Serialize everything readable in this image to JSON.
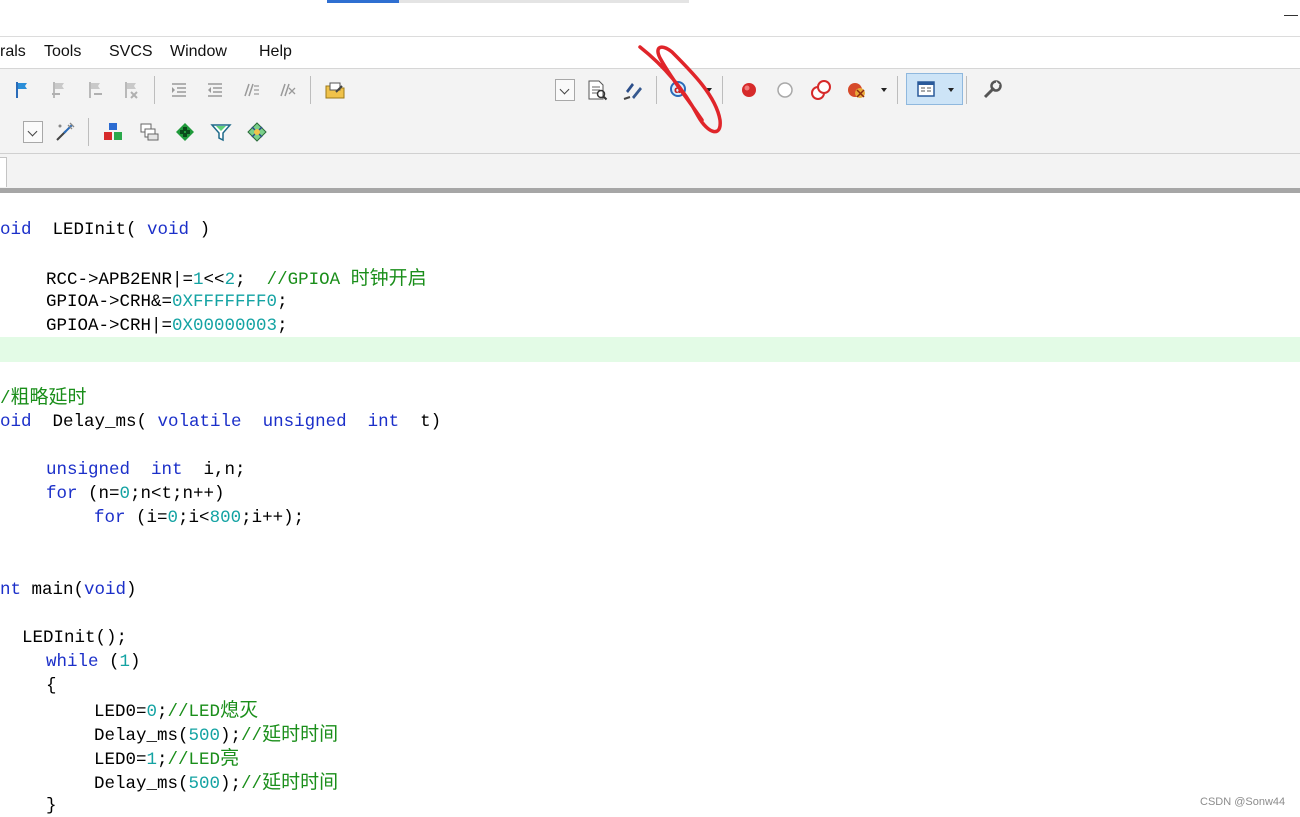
{
  "window": {
    "minimize_glyph": "—"
  },
  "menu": {
    "items": [
      "rals",
      "Tools",
      "SVCS",
      "Window",
      "Help"
    ]
  },
  "toolbar": {
    "row1_icons": [
      "bookmark-icon",
      "prev-bookmark-icon",
      "next-bookmark-icon",
      "clear-bookmarks-icon",
      "indent-icon",
      "unindent-icon",
      "comment-icon",
      "uncomment-icon",
      "find-in-files-icon",
      "find-combo-icon",
      "incremental-find-icon",
      "browse-symbols-icon",
      "debug-session-icon",
      "insert-breakpoint-icon",
      "enable-breakpoint-icon",
      "disable-breakpoints-icon",
      "kill-breakpoints-icon",
      "window-layout-icon",
      "configure-icon"
    ],
    "row2_icons": [
      "target-combo-icon",
      "target-options-icon",
      "manage-components-icon",
      "file-extensions-icon",
      "pack-installer-icon",
      "select-device-icon",
      "manage-packs-icon"
    ],
    "accent_blue": "#2f6fd1",
    "breakpoint_red": "#d62a2a"
  },
  "editor": {
    "highlight_color": "#e3fbe6",
    "keyword_color": "#1b2fc9",
    "number_color": "#14a3a3",
    "comment_color": "#1a8e1a",
    "lines": {
      "l1": {
        "a": "oid",
        "b": "  LEDInit( ",
        "c": "void",
        "d": " )"
      },
      "l2": {
        "a": "RCC->APB2ENR|=",
        "b": "1",
        "c": "<<",
        "d": "2",
        "e": ";  ",
        "f": "//GPIOA ",
        "g": "时钟开启"
      },
      "l3": {
        "a": "GPIOA->CRH&=",
        "b": "0XFFFFFFF0",
        "c": ";"
      },
      "l4": {
        "a": "GPIOA->CRH|=",
        "b": "0X00000003",
        "c": ";"
      },
      "l5": {
        "a": "/",
        "b": "粗略延时"
      },
      "l6": {
        "a": "oid",
        "b": "  Delay_ms( ",
        "c": "volatile",
        "d": "  ",
        "e": "unsigned",
        "f": "  ",
        "g": "int",
        "h": "  t)"
      },
      "l7": {
        "a": "unsigned",
        "b": "  ",
        "c": "int",
        "d": "  i,n;"
      },
      "l8": {
        "a": "for",
        "b": " (n=",
        "c": "0",
        "d": ";n<t;n++)"
      },
      "l9": {
        "a": "for",
        "b": " (i=",
        "c": "0",
        "d": ";i<",
        "e": "800",
        "f": ";i++);"
      },
      "l10": {
        "a": "nt",
        "b": " main(",
        "c": "void",
        "d": ")"
      },
      "l11": {
        "a": "LEDInit();"
      },
      "l12": {
        "a": "while",
        "b": " (",
        "c": "1",
        "d": ")"
      },
      "l13": {
        "a": "{"
      },
      "l14": {
        "a": "LED0=",
        "b": "0",
        "c": ";",
        "d": "//LED",
        "e": "熄灭"
      },
      "l15": {
        "a": "Delay_ms(",
        "b": "500",
        "c": ");",
        "d": "//",
        "e": "延时时间"
      },
      "l16": {
        "a": "LED0=",
        "b": "1",
        "c": ";",
        "d": "//LED",
        "e": "亮"
      },
      "l17": {
        "a": "Delay_ms(",
        "b": "500",
        "c": ");",
        "d": "//",
        "e": "延时时间"
      },
      "l18": {
        "a": "}"
      }
    }
  },
  "watermark": "CSDN @Sonw44"
}
